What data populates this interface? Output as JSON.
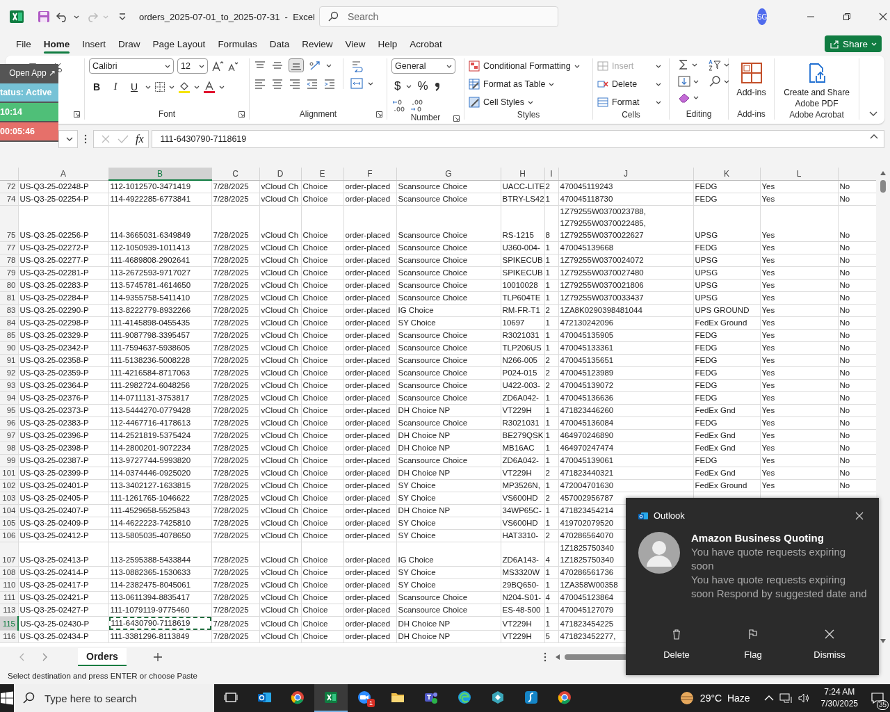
{
  "title_bar": {
    "file_title": "orders_2025-07-01_to_2025-07-31  -  Excel",
    "search": {
      "placeholder": "Search"
    },
    "avatar": "SG"
  },
  "ribbon_tabs": [
    {
      "label": "File",
      "selected": false
    },
    {
      "label": "Home",
      "selected": true
    },
    {
      "label": "Insert",
      "selected": false
    },
    {
      "label": "Draw",
      "selected": false
    },
    {
      "label": "Page Layout",
      "selected": false
    },
    {
      "label": "Formulas",
      "selected": false
    },
    {
      "label": "Data",
      "selected": false
    },
    {
      "label": "Review",
      "selected": false
    },
    {
      "label": "View",
      "selected": false
    },
    {
      "label": "Help",
      "selected": false
    },
    {
      "label": "Acrobat",
      "selected": false
    }
  ],
  "share_button": "Share",
  "ribbon": {
    "font": {
      "family": "Calibri",
      "size": "12",
      "buttons": [
        "B",
        "I",
        "U"
      ],
      "label": "Font"
    },
    "alignment": {
      "label": "Alignment"
    },
    "number": {
      "format": "General",
      "symbols": [
        "$",
        "%"
      ],
      "label": "Number"
    },
    "styles": {
      "items": [
        "Conditional Formatting",
        "Format as Table",
        "Cell Styles"
      ],
      "label": "Styles"
    },
    "cells": {
      "items": [
        {
          "label": "Insert",
          "disabled": true
        },
        {
          "label": "Delete",
          "disabled": false
        },
        {
          "label": "Format",
          "disabled": false
        }
      ],
      "label": "Cells"
    },
    "editing": {
      "label": "Editing"
    },
    "addins": {
      "button": "Add-ins",
      "label": "Add-ins"
    },
    "acrobat": {
      "button": "Create and Share Adobe PDF",
      "label": "Adobe Acrobat"
    }
  },
  "timer_overlay": {
    "button": "Open App ↗",
    "status": "tatus: Active",
    "clock": "10:14",
    "elapsed": "00:05:46"
  },
  "formula_bar": {
    "fx": "fx",
    "value": "111-6430790-7118619"
  },
  "sheet": {
    "columns": [
      {
        "label": "A",
        "selected": false
      },
      {
        "label": "B",
        "selected": true
      },
      {
        "label": "C",
        "selected": false
      },
      {
        "label": "D",
        "selected": false
      },
      {
        "label": "E",
        "selected": false
      },
      {
        "label": "F",
        "selected": false
      },
      {
        "label": "G",
        "selected": false
      },
      {
        "label": "H",
        "selected": false
      },
      {
        "label": "I",
        "selected": false
      },
      {
        "label": "J",
        "selected": false
      },
      {
        "label": "K",
        "selected": false
      },
      {
        "label": "L",
        "selected": false
      }
    ],
    "rows": [
      {
        "header": "72",
        "selected": false,
        "cells": [
          "US-Q3-25-02248-P",
          "112-1012570-3471419",
          "7/28/2025",
          "vCloud Ch",
          "Choice",
          "order-placed",
          "Scansource Choice",
          "UACC-LITE",
          "2",
          "470045119243",
          "FEDG",
          "Yes",
          "No"
        ]
      },
      {
        "header": "74",
        "selected": false,
        "cells": [
          "US-Q3-25-02254-P",
          "114-4922285-6773841",
          "7/28/2025",
          "vCloud Ch",
          "Choice",
          "order-placed",
          "Scansource Choice",
          "BTRY-LS42",
          "1",
          "470045118730",
          "FEDG",
          "Yes",
          "No"
        ]
      },
      {
        "header": "75",
        "selected": false,
        "cells": [
          "US-Q3-25-02256-P",
          "114-3665031-6349849",
          "7/28/2025",
          "vCloud Ch",
          "Choice",
          "order-placed",
          "Scansource Choice",
          "RS-1215",
          "8",
          "1Z79255W0370023788,\n1Z79255W0370022485,\n1Z79255W0370022627",
          "UPSG",
          "Yes",
          "No"
        ]
      },
      {
        "header": "77",
        "selected": false,
        "cells": [
          "US-Q3-25-02272-P",
          "112-1050939-1011413",
          "7/28/2025",
          "vCloud Ch",
          "Choice",
          "order-placed",
          "Scansource Choice",
          "U360-004-",
          "1",
          "470045139668",
          "FEDG",
          "Yes",
          "No"
        ]
      },
      {
        "header": "78",
        "selected": false,
        "cells": [
          "US-Q3-25-02277-P",
          "111-4689808-2902641",
          "7/28/2025",
          "vCloud Ch",
          "Choice",
          "order-placed",
          "Scansource Choice",
          "SPIKECUB",
          "1",
          "1Z79255W0370024072",
          "UPSG",
          "Yes",
          "No"
        ]
      },
      {
        "header": "79",
        "selected": false,
        "cells": [
          "US-Q3-25-02281-P",
          "113-2672593-9717027",
          "7/28/2025",
          "vCloud Ch",
          "Choice",
          "order-placed",
          "Scansource Choice",
          "SPIKECUB",
          "1",
          "1Z79255W0370027480",
          "UPSG",
          "Yes",
          "No"
        ]
      },
      {
        "header": "80",
        "selected": false,
        "cells": [
          "US-Q3-25-02283-P",
          "113-5745781-4614650",
          "7/28/2025",
          "vCloud Ch",
          "Choice",
          "order-placed",
          "Scansource Choice",
          "10010028",
          "1",
          "1Z79255W0370021806",
          "UPSG",
          "Yes",
          "No"
        ]
      },
      {
        "header": "81",
        "selected": false,
        "cells": [
          "US-Q3-25-02284-P",
          "114-9355758-5411410",
          "7/28/2025",
          "vCloud Ch",
          "Choice",
          "order-placed",
          "Scansource Choice",
          "TLP604TE",
          "1",
          "1Z79255W0370033437",
          "UPSG",
          "Yes",
          "No"
        ]
      },
      {
        "header": "83",
        "selected": false,
        "cells": [
          "US-Q3-25-02290-P",
          "113-8222779-8932266",
          "7/28/2025",
          "vCloud Ch",
          "Choice",
          "order-placed",
          "IG Choice",
          "RM-FR-T1",
          "2",
          "1ZA8K0290398481044",
          "UPS GROUND",
          "Yes",
          "No"
        ]
      },
      {
        "header": "84",
        "selected": false,
        "cells": [
          "US-Q3-25-02298-P",
          "111-4145898-0455435",
          "7/28/2025",
          "vCloud Ch",
          "Choice",
          "order-placed",
          "SY Choice",
          "10697",
          "1",
          "472130242096",
          "FedEx Ground",
          "Yes",
          "No"
        ]
      },
      {
        "header": "85",
        "selected": false,
        "cells": [
          "US-Q3-25-02329-P",
          "111-9087798-3395457",
          "7/28/2025",
          "vCloud Ch",
          "Choice",
          "order-placed",
          "Scansource Choice",
          "R3021031",
          "1",
          "470045135905",
          "FEDG",
          "Yes",
          "No"
        ]
      },
      {
        "header": "90",
        "selected": false,
        "cells": [
          "US-Q3-25-02342-P",
          "111-7594637-5938605",
          "7/28/2025",
          "vCloud Ch",
          "Choice",
          "order-placed",
          "Scansource Choice",
          "TLP206US",
          "1",
          "470045133361",
          "FEDG",
          "Yes",
          "No"
        ]
      },
      {
        "header": "91",
        "selected": false,
        "cells": [
          "US-Q3-25-02358-P",
          "111-5138236-5008228",
          "7/28/2025",
          "vCloud Ch",
          "Choice",
          "order-placed",
          "Scansource Choice",
          "N266-005",
          "2",
          "470045135651",
          "FEDG",
          "Yes",
          "No"
        ]
      },
      {
        "header": "92",
        "selected": false,
        "cells": [
          "US-Q3-25-02359-P",
          "111-4216584-8717063",
          "7/28/2025",
          "vCloud Ch",
          "Choice",
          "order-placed",
          "Scansource Choice",
          "P024-015",
          "2",
          "470045123989",
          "FEDG",
          "Yes",
          "No"
        ]
      },
      {
        "header": "93",
        "selected": false,
        "cells": [
          "US-Q3-25-02364-P",
          "111-2982724-6048256",
          "7/28/2025",
          "vCloud Ch",
          "Choice",
          "order-placed",
          "Scansource Choice",
          "U422-003-",
          "2",
          "470045139072",
          "FEDG",
          "Yes",
          "No"
        ]
      },
      {
        "header": "94",
        "selected": false,
        "cells": [
          "US-Q3-25-02376-P",
          "114-0711131-3753817",
          "7/28/2025",
          "vCloud Ch",
          "Choice",
          "order-placed",
          "Scansource Choice",
          "ZD6A042-",
          "1",
          "470045136636",
          "FEDG",
          "Yes",
          "No"
        ]
      },
      {
        "header": "95",
        "selected": false,
        "cells": [
          "US-Q3-25-02373-P",
          "113-5444270-0779428",
          "7/28/2025",
          "vCloud Ch",
          "Choice",
          "order-placed",
          "DH Choice NP",
          "VT229H",
          "1",
          "471823446260",
          "FedEx Gnd",
          "Yes",
          "No"
        ]
      },
      {
        "header": "96",
        "selected": false,
        "cells": [
          "US-Q3-25-02383-P",
          "112-4467716-4178613",
          "7/28/2025",
          "vCloud Ch",
          "Choice",
          "order-placed",
          "Scansource Choice",
          "R3021031",
          "1",
          "470045136084",
          "FEDG",
          "Yes",
          "No"
        ]
      },
      {
        "header": "97",
        "selected": false,
        "cells": [
          "US-Q3-25-02396-P",
          "114-2521819-5375424",
          "7/28/2025",
          "vCloud Ch",
          "Choice",
          "order-placed",
          "DH Choice NP",
          "BE279QSK",
          "1",
          "464970246890",
          "FedEx Gnd",
          "Yes",
          "No"
        ]
      },
      {
        "header": "98",
        "selected": false,
        "cells": [
          "US-Q3-25-02398-P",
          "114-2800201-9072234",
          "7/28/2025",
          "vCloud Ch",
          "Choice",
          "order-placed",
          "DH Choice NP",
          "MB16AC",
          "1",
          "464970247474",
          "FedEx Gnd",
          "Yes",
          "No"
        ]
      },
      {
        "header": "99",
        "selected": false,
        "cells": [
          "US-Q3-25-02387-P",
          "113-9727744-5993820",
          "7/28/2025",
          "vCloud Ch",
          "Choice",
          "order-placed",
          "Scansource Choice",
          "ZD6A042-",
          "1",
          "470045139061",
          "FEDG",
          "Yes",
          "No"
        ]
      },
      {
        "header": "101",
        "selected": false,
        "cells": [
          "US-Q3-25-02399-P",
          "114-0374446-0925020",
          "7/28/2025",
          "vCloud Ch",
          "Choice",
          "order-placed",
          "DH Choice NP",
          "VT229H",
          "2",
          "471823440321",
          "FedEx Gnd",
          "Yes",
          "No"
        ]
      },
      {
        "header": "102",
        "selected": false,
        "cells": [
          "US-Q3-25-02401-P",
          "113-3402127-1633815",
          "7/28/2025",
          "vCloud Ch",
          "Choice",
          "order-placed",
          "SY Choice",
          "MP3526N,",
          "1",
          "472004701630",
          "FedEx Ground",
          "Yes",
          "No"
        ]
      },
      {
        "header": "103",
        "selected": false,
        "cells": [
          "US-Q3-25-02405-P",
          "111-1261765-1046622",
          "7/28/2025",
          "vCloud Ch",
          "Choice",
          "order-placed",
          "SY Choice",
          "VS600HD",
          "2",
          "457002956787"
        ]
      },
      {
        "header": "104",
        "selected": false,
        "cells": [
          "US-Q3-25-02407-P",
          "111-4529658-5525843",
          "7/28/2025",
          "vCloud Ch",
          "Choice",
          "order-placed",
          "DH Choice NP",
          "34WP65C-",
          "1",
          "471823454214"
        ]
      },
      {
        "header": "105",
        "selected": false,
        "cells": [
          "US-Q3-25-02409-P",
          "114-4622223-7425810",
          "7/28/2025",
          "vCloud Ch",
          "Choice",
          "order-placed",
          "SY Choice",
          "VS600HD",
          "1",
          "419702079520"
        ]
      },
      {
        "header": "106",
        "selected": false,
        "cells": [
          "US-Q3-25-02412-P",
          "113-5805035-4078650",
          "7/28/2025",
          "vCloud Ch",
          "Choice",
          "order-placed",
          "SY Choice",
          "HAT3310-",
          "2",
          "470286564070"
        ]
      },
      {
        "header": "107",
        "selected": false,
        "cells": [
          "US-Q3-25-02413-P",
          "113-2595388-5433844",
          "7/28/2025",
          "vCloud Ch",
          "Choice",
          "order-placed",
          "IG Choice",
          "ZD6A143-",
          "4",
          "1Z1825750340\n1Z1825750340"
        ]
      },
      {
        "header": "108",
        "selected": false,
        "cells": [
          "US-Q3-25-02414-P",
          "113-0882365-1530633",
          "7/28/2025",
          "vCloud Ch",
          "Choice",
          "order-placed",
          "SY Choice",
          "MS3320W",
          "1",
          "470286561736"
        ]
      },
      {
        "header": "110",
        "selected": false,
        "cells": [
          "US-Q3-25-02417-P",
          "114-2382475-8045061",
          "7/28/2025",
          "vCloud Ch",
          "Choice",
          "order-placed",
          "SY Choice",
          "29BQ650-",
          "1",
          "1ZA358W00358"
        ]
      },
      {
        "header": "111",
        "selected": false,
        "cells": [
          "US-Q3-25-02421-P",
          "113-0611394-8835417",
          "7/28/2025",
          "vCloud Ch",
          "Choice",
          "order-placed",
          "Scansource Choice",
          "N204-S01-",
          "4",
          "470045123864"
        ]
      },
      {
        "header": "113",
        "selected": false,
        "cells": [
          "US-Q3-25-02427-P",
          "111-1079119-9775460",
          "7/28/2025",
          "vCloud Ch",
          "Choice",
          "order-placed",
          "Scansource Choice",
          "ES-48-500",
          "1",
          "470045127079"
        ]
      },
      {
        "header": "115",
        "selected": true,
        "cells": [
          "US-Q3-25-02430-P",
          "111-6430790-7118619",
          "7/28/2025",
          "vCloud Ch",
          "Choice",
          "order-placed",
          "DH Choice NP",
          "VT229H",
          "1",
          "471823454225"
        ]
      },
      {
        "header": "116",
        "selected": false,
        "cells": [
          "US-Q3-25-02434-P",
          "111-3381296-8113849",
          "7/28/2025",
          "vCloud Ch",
          "Choice",
          "order-placed",
          "DH Choice NP",
          "VT229H",
          "5",
          "471823452277,"
        ]
      }
    ]
  },
  "sheet_tabs": [
    {
      "label": "Orders",
      "selected": true
    }
  ],
  "status_bar": {
    "message": "Select destination and press ENTER or choose Paste"
  },
  "notification": {
    "app": "Outlook",
    "sender": "Amazon Business Quoting",
    "lines": [
      "You have quote requests expiring soon",
      "You have quote requests expiring soon  Respond by suggested date and"
    ],
    "actions": [
      {
        "kind": "delete",
        "label": "Delete"
      },
      {
        "kind": "flag",
        "label": "Flag"
      },
      {
        "kind": "dismiss",
        "label": "Dismiss"
      }
    ]
  },
  "taskbar": {
    "search_placeholder": "Type here to search",
    "apps": [
      {
        "kind": "taskview",
        "active": false
      },
      {
        "kind": "outlook",
        "active": false
      },
      {
        "kind": "chrome",
        "active": false
      },
      {
        "kind": "excel",
        "active": true
      },
      {
        "kind": "zoom",
        "active": false,
        "badge": "1"
      },
      {
        "kind": "explorer",
        "active": false
      },
      {
        "kind": "teams",
        "active": false
      },
      {
        "kind": "edge",
        "active": false
      },
      {
        "kind": "cube",
        "active": false
      },
      {
        "kind": "script",
        "active": false
      },
      {
        "kind": "chrome",
        "active": false
      }
    ],
    "weather": "29°C  Haze",
    "time": "7:24 AM",
    "date": "7/30/2025",
    "notification_count": "35"
  }
}
